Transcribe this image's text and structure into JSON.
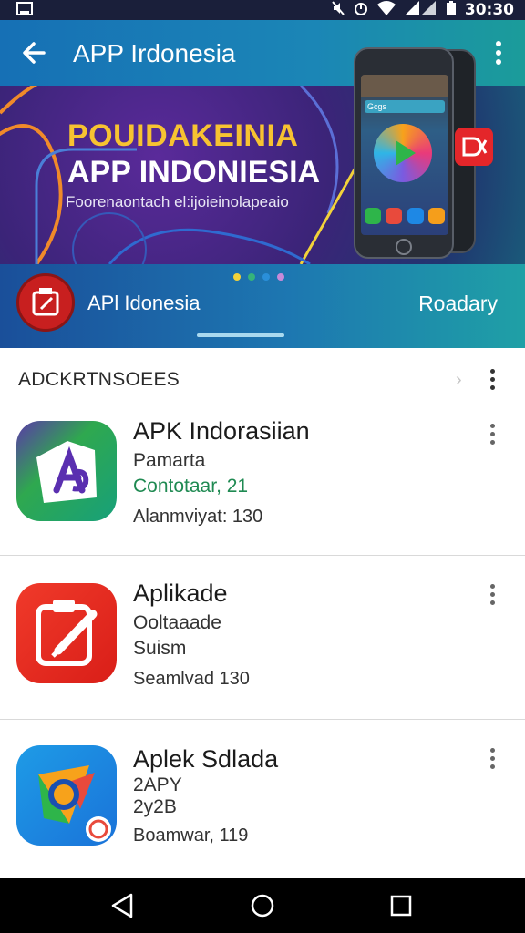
{
  "status_bar": {
    "time": "30:30",
    "icons": [
      "sim-card-icon",
      "mute-icon",
      "alarm-icon",
      "wifi-icon",
      "signal-icon",
      "battery-icon"
    ]
  },
  "app_bar": {
    "title": "APP Irdonesia",
    "back_icon": "arrow-left-icon",
    "menu_icon": "more-vert-icon"
  },
  "banner": {
    "headline": "POUIDAKEINIA",
    "subhead": "APP INDONIESIA",
    "tagline": "Foorenaontach el:ijoieinolapeaio",
    "phone_search_text": "Gcgs",
    "colors": {
      "headline": "#f7c331",
      "badge": "#e4262a"
    }
  },
  "featured": {
    "app_name": "APl Idonesia",
    "action_label": "Roadary",
    "carousel_dots": [
      "#f2d23a",
      "#35b37a",
      "#2a8fd9",
      "#c78ad9"
    ]
  },
  "section": {
    "title": "ADCKRTNSOEES",
    "chevron_icon": "chevron-right-icon",
    "menu_icon": "more-vert-icon"
  },
  "apps": [
    {
      "name": "APK Indorasiian",
      "line1": "Pamarta",
      "line2": "Contotaar, 21",
      "meta": "Alanmviyat: 130",
      "icon": "apk-a-icon",
      "icon_colors": [
        "#2fa84f",
        "#17a07a"
      ]
    },
    {
      "name": "Aplikade",
      "line1": "Ooltaaade",
      "line2": "Suism",
      "meta": "Seamlvad 130",
      "icon": "clipboard-pen-icon",
      "icon_colors": [
        "#e8261f",
        "#d91e18"
      ]
    },
    {
      "name": "Aplek Sdlada",
      "line1": "2APY",
      "line2": "2y2B",
      "meta": "Boamwar, 119",
      "icon": "colorful-shape-icon",
      "icon_colors": [
        "#1a73d9",
        "#2196f3"
      ]
    }
  ],
  "nav_bar": {
    "back_icon": "nav-back-triangle-icon",
    "home_icon": "nav-home-circle-icon",
    "recents_icon": "nav-recents-square-icon"
  }
}
